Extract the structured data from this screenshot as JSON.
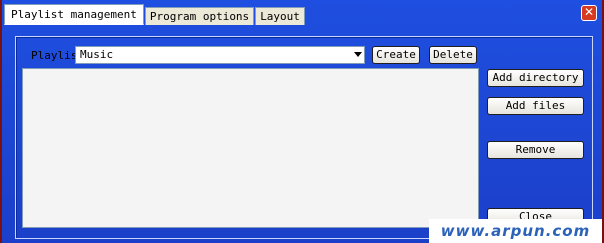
{
  "tabs": [
    {
      "label": "Playlist management"
    },
    {
      "label": "Program options"
    },
    {
      "label": "Layout"
    }
  ],
  "close_icon": "close-icon",
  "playlist": {
    "label": "Playlis",
    "selected": "Music"
  },
  "buttons": {
    "create": "Create",
    "delete": "Delete",
    "add_directory": "Add directory",
    "add_files": "Add files",
    "remove": "Remove",
    "close": "Close"
  },
  "watermark": "www.arpun.com",
  "colors": {
    "window_bg": "#1f4fe0",
    "close_red": "#d63a1f"
  }
}
